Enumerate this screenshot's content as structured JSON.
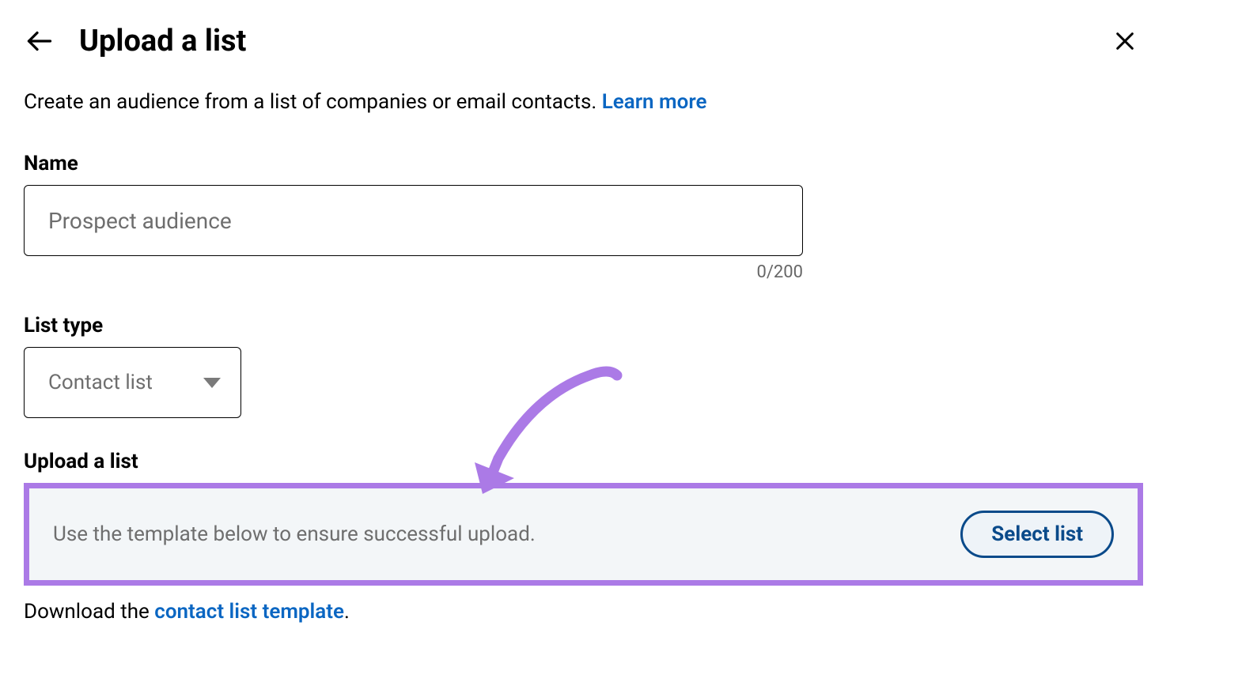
{
  "header": {
    "title": "Upload a list"
  },
  "description": {
    "text": "Create an audience from a list of companies or email contacts. ",
    "learn_more_label": "Learn more"
  },
  "name_field": {
    "label": "Name",
    "placeholder": "Prospect audience",
    "counter": "0/200"
  },
  "list_type_field": {
    "label": "List type",
    "selected": "Contact list"
  },
  "upload_section": {
    "label": "Upload a list",
    "hint": "Use the template below to ensure successful upload.",
    "button_label": "Select list"
  },
  "download": {
    "prefix": "Download the ",
    "link_label": "contact list template",
    "suffix": "."
  },
  "colors": {
    "link": "#0a66c2",
    "accent_border": "#ab7ae6",
    "button_border": "#0a4a8a"
  }
}
